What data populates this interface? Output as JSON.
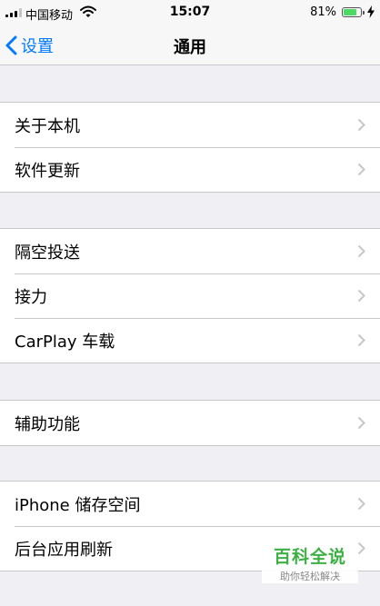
{
  "status_bar": {
    "carrier": "中国移动",
    "time": "15:07",
    "battery_percent": "81%",
    "battery_level": 0.81,
    "signal_bars_active": 3,
    "signal_bars_total": 4
  },
  "nav": {
    "back_label": "设置",
    "title": "通用"
  },
  "groups": [
    {
      "items": [
        {
          "label": "关于本机"
        },
        {
          "label": "软件更新"
        }
      ]
    },
    {
      "items": [
        {
          "label": "隔空投送"
        },
        {
          "label": "接力"
        },
        {
          "label": "CarPlay 车载"
        }
      ]
    },
    {
      "items": [
        {
          "label": "辅助功能"
        }
      ]
    },
    {
      "items": [
        {
          "label": "iPhone 储存空间"
        },
        {
          "label": "后台应用刷新"
        }
      ]
    }
  ],
  "watermark": {
    "title": "百科全说",
    "subtitle": "助你轻松解决"
  },
  "colors": {
    "accent": "#007aff",
    "battery": "#4cd964",
    "watermark": "#3cb043",
    "background": "#efeff4"
  },
  "icons": {
    "back": "chevron-left-icon",
    "disclosure": "chevron-right-icon",
    "wifi": "wifi-icon",
    "battery": "battery-icon",
    "charging": "lightning-bolt-icon",
    "signal": "cellular-signal-icon"
  }
}
